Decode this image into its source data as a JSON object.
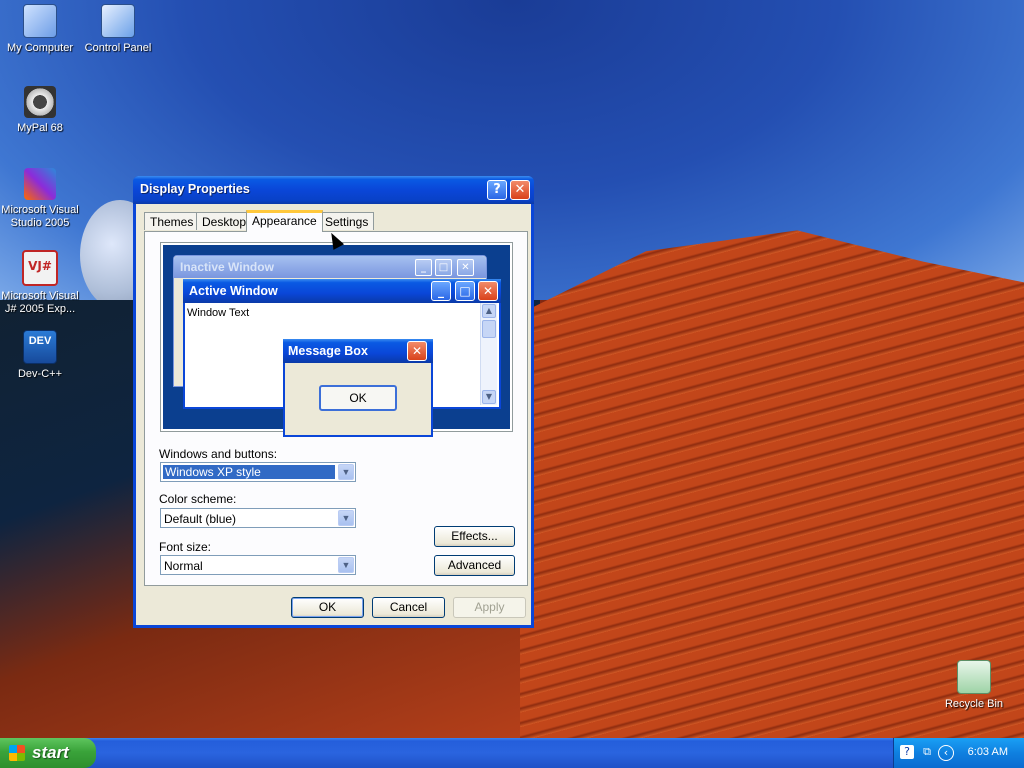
{
  "desktop": {
    "icons": [
      {
        "label": "My Computer"
      },
      {
        "label": "Control Panel"
      },
      {
        "label": "MyPal 68"
      },
      {
        "label": "Microsoft Visual Studio 2005"
      },
      {
        "label": "Microsoft Visual J# 2005 Exp..."
      },
      {
        "label": "Dev-C++"
      },
      {
        "label": "Recycle Bin"
      }
    ],
    "vj_badge": "VJ#",
    "dev_badge": "DEV"
  },
  "dialog": {
    "title": "Display Properties",
    "help_glyph": "?",
    "close_glyph": "✕",
    "tabs": [
      {
        "label": "Themes"
      },
      {
        "label": "Desktop"
      },
      {
        "label": "Appearance",
        "active": true
      },
      {
        "label": "Settings"
      }
    ],
    "preview": {
      "inactive_title": "Inactive Window",
      "active_title": "Active Window",
      "window_text": "Window Text",
      "msgbox_title": "Message Box",
      "msgbox_ok": "OK"
    },
    "windows_buttons": {
      "label": "Windows and buttons:",
      "value": "Windows XP style"
    },
    "color_scheme": {
      "label": "Color scheme:",
      "value": "Default (blue)"
    },
    "font_size": {
      "label": "Font size:",
      "value": "Normal"
    },
    "effects_button": "Effects...",
    "advanced_button": "Advanced",
    "ok_button": "OK",
    "cancel_button": "Cancel",
    "apply_button": "Apply"
  },
  "taskbar": {
    "start_label": "start",
    "clock": "6:03 AM"
  },
  "colors": {
    "xp_blue": "#0a46d8",
    "dialog_bg": "#ece9d8",
    "start_green": "#3aa33a"
  }
}
